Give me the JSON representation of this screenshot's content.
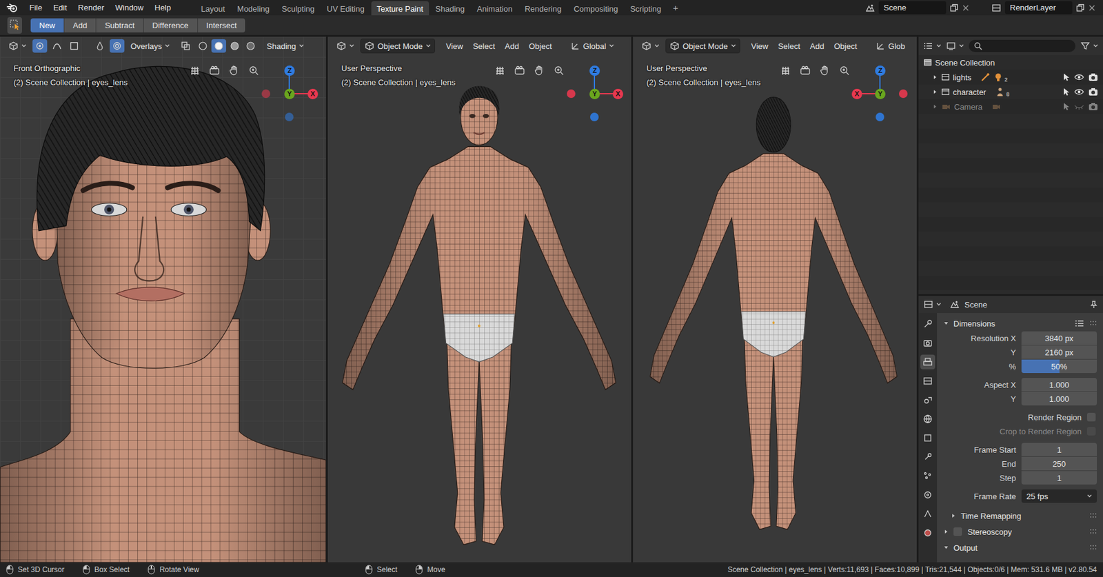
{
  "topbar": {
    "menu": [
      "File",
      "Edit",
      "Render",
      "Window",
      "Help"
    ],
    "workspaces": [
      {
        "label": "Layout",
        "selected": false
      },
      {
        "label": "Modeling",
        "selected": false
      },
      {
        "label": "Sculpting",
        "selected": false
      },
      {
        "label": "UV Editing",
        "selected": false
      },
      {
        "label": "Texture Paint",
        "selected": true
      },
      {
        "label": "Shading",
        "selected": false
      },
      {
        "label": "Animation",
        "selected": false
      },
      {
        "label": "Rendering",
        "selected": false
      },
      {
        "label": "Compositing",
        "selected": false
      },
      {
        "label": "Scripting",
        "selected": false
      }
    ],
    "add_workspace": "+",
    "scene": "Scene",
    "view_layer": "RenderLayer"
  },
  "tool_header": {
    "modes": [
      {
        "label": "New",
        "selected": true
      },
      {
        "label": "Add",
        "selected": false
      },
      {
        "label": "Subtract",
        "selected": false
      },
      {
        "label": "Difference",
        "selected": false
      },
      {
        "label": "Intersect",
        "selected": false
      }
    ]
  },
  "viewports": [
    {
      "kind": "head",
      "header_toggles": [
        {
          "selected": true
        },
        {
          "selected": false
        },
        {
          "selected": false
        },
        {
          "selected": false
        },
        {
          "selected": true
        }
      ],
      "header": [
        {
          "label": "Overlays",
          "kind": "overlays"
        },
        {
          "label": "Shading",
          "kind": "shading"
        }
      ],
      "shading_buttons": [
        {
          "selected": false
        },
        {
          "selected": true
        },
        {
          "selected": false
        },
        {
          "selected": false
        }
      ],
      "view_name": "Front Orthographic",
      "collection": "(2) Scene Collection | eyes_lens",
      "axes": [
        {
          "label": "Z",
          "color": "#2f7be0"
        },
        {
          "label": "Y",
          "color": "#6aa61e"
        },
        {
          "label": "X",
          "color": "#e8384f"
        }
      ]
    },
    {
      "kind": "front",
      "header_toggles": [],
      "header": [
        {
          "label": "Object Mode",
          "kind": "mode"
        },
        {
          "label": "View",
          "kind": "menu"
        },
        {
          "label": "Select",
          "kind": "menu"
        },
        {
          "label": "Add",
          "kind": "menu"
        },
        {
          "label": "Object",
          "kind": "menu"
        },
        {
          "label": "Global",
          "kind": "dropdown"
        }
      ],
      "view_name": "User Perspective",
      "collection": "(2) Scene Collection | eyes_lens",
      "axes": [
        {
          "label": "Z",
          "color": "#2f7be0"
        },
        {
          "label": "Y",
          "color": "#6aa61e"
        },
        {
          "label": "X",
          "color": "#e8384f"
        }
      ]
    },
    {
      "kind": "back",
      "header_toggles": [],
      "header": [
        {
          "label": "Object Mode",
          "kind": "mode"
        },
        {
          "label": "View",
          "kind": "menu"
        },
        {
          "label": "Select",
          "kind": "menu"
        },
        {
          "label": "Add",
          "kind": "menu"
        },
        {
          "label": "Object",
          "kind": "menu"
        },
        {
          "label": "Glob",
          "kind": "truncated"
        }
      ],
      "view_name": "User Perspective",
      "collection": "(2) Scene Collection | eyes_lens",
      "axes": [
        {
          "label": "Z",
          "color": "#2f7be0"
        },
        {
          "label": "Y",
          "color": "#6aa61e"
        },
        {
          "label": "X",
          "color": "#e8384f"
        }
      ]
    }
  ],
  "outliner": {
    "items": [
      {
        "label": "Scene Collection",
        "kind": "scene",
        "level": 0,
        "visible": true,
        "disabled": false
      },
      {
        "label": "lights",
        "kind": "lights",
        "level": 1,
        "expanded": false,
        "badge": "2",
        "visible": true,
        "disabled": false
      },
      {
        "label": "character",
        "kind": "character",
        "level": 1,
        "expanded": false,
        "badge": "8",
        "visible": true,
        "disabled": false
      },
      {
        "label": "Camera",
        "kind": "camera",
        "level": 1,
        "expanded": false,
        "visible": false,
        "disabled": true
      }
    ]
  },
  "properties": {
    "context": "Scene",
    "tabs": [
      {
        "selected": false
      },
      {
        "selected": false
      },
      {
        "selected": true
      },
      {
        "selected": false
      },
      {
        "selected": false
      },
      {
        "selected": false
      },
      {
        "selected": false
      },
      {
        "selected": false
      },
      {
        "selected": false
      },
      {
        "selected": false
      },
      {
        "selected": false
      },
      {
        "selected": false
      }
    ],
    "dimensions": {
      "title": "Dimensions",
      "expanded": true,
      "groups": [
        [
          {
            "kind": "field",
            "label": "Resolution X",
            "value": "3840 px"
          },
          {
            "kind": "field",
            "label": "Y",
            "value": "2160 px"
          },
          {
            "kind": "slider",
            "label": "%",
            "value": "50%",
            "level": 0.5
          }
        ],
        [
          {
            "kind": "field",
            "label": "Aspect X",
            "value": "1.000"
          },
          {
            "kind": "field",
            "label": "Y",
            "value": "1.000"
          }
        ],
        [
          {
            "kind": "checkbox",
            "label": "Render Region",
            "checked": false,
            "disabled": false
          },
          {
            "kind": "checkbox",
            "label": "Crop to Render Region",
            "checked": false,
            "disabled": true
          }
        ],
        [
          {
            "kind": "field",
            "label": "Frame Start",
            "value": "1"
          },
          {
            "kind": "field",
            "label": "End",
            "value": "250"
          },
          {
            "kind": "field",
            "label": "Step",
            "value": "1"
          }
        ],
        [
          {
            "kind": "dropdown",
            "label": "Frame Rate",
            "value": "25 fps"
          }
        ]
      ]
    },
    "panels": [
      {
        "title": "Time Remapping",
        "kind": "sub",
        "expanded": false
      },
      {
        "title": "Stereoscopy",
        "kind": "toggle",
        "expanded": false,
        "checked": false
      },
      {
        "title": "Output",
        "kind": "panel",
        "expanded": true
      }
    ]
  },
  "status": {
    "hints": [
      {
        "label": "Set 3D Cursor"
      },
      {
        "label": "Box Select"
      },
      {
        "label": "Rotate View"
      },
      {
        "label": "Select"
      },
      {
        "label": "Move"
      }
    ],
    "stats": "Scene Collection | eyes_lens | Verts:11,693 | Faces:10,899 | Tris:21,544 | Objects:0/6 | Mem: 531.6 MB | v2.80.54"
  }
}
